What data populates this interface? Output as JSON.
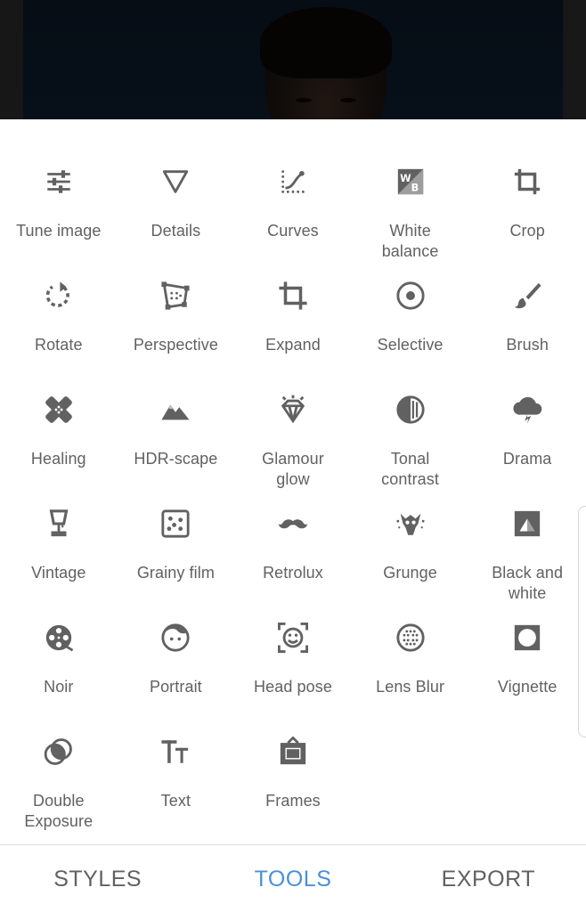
{
  "theme": {
    "icon_color": "#616161",
    "label_color": "#616161",
    "active_tab_color": "#4a90d9"
  },
  "tools": [
    {
      "label": "Tune image",
      "icon": "tune-icon"
    },
    {
      "label": "Details",
      "icon": "details-triangle-icon"
    },
    {
      "label": "Curves",
      "icon": "curves-icon"
    },
    {
      "label": "White\nbalance",
      "icon": "white-balance-icon"
    },
    {
      "label": "Crop",
      "icon": "crop-icon"
    },
    {
      "label": "Rotate",
      "icon": "rotate-icon"
    },
    {
      "label": "Perspective",
      "icon": "perspective-icon"
    },
    {
      "label": "Expand",
      "icon": "expand-icon"
    },
    {
      "label": "Selective",
      "icon": "selective-icon"
    },
    {
      "label": "Brush",
      "icon": "brush-icon"
    },
    {
      "label": "Healing",
      "icon": "healing-icon"
    },
    {
      "label": "HDR-scape",
      "icon": "hdr-mountains-icon"
    },
    {
      "label": "Glamour\nglow",
      "icon": "glamour-diamond-icon"
    },
    {
      "label": "Tonal\ncontrast",
      "icon": "tonal-contrast-icon"
    },
    {
      "label": "Drama",
      "icon": "drama-cloud-icon"
    },
    {
      "label": "Vintage",
      "icon": "vintage-lamp-icon"
    },
    {
      "label": "Grainy film",
      "icon": "grainy-film-icon"
    },
    {
      "label": "Retrolux",
      "icon": "retrolux-mustache-icon"
    },
    {
      "label": "Grunge",
      "icon": "grunge-icon"
    },
    {
      "label": "Black and\nwhite",
      "icon": "black-white-icon"
    },
    {
      "label": "Noir",
      "icon": "noir-film-reel-icon"
    },
    {
      "label": "Portrait",
      "icon": "portrait-face-icon"
    },
    {
      "label": "Head pose",
      "icon": "head-pose-icon"
    },
    {
      "label": "Lens Blur",
      "icon": "lens-blur-icon"
    },
    {
      "label": "Vignette",
      "icon": "vignette-icon"
    },
    {
      "label": "Double\nExposure",
      "icon": "double-exposure-icon"
    },
    {
      "label": "Text",
      "icon": "text-icon"
    },
    {
      "label": "Frames",
      "icon": "frames-icon"
    }
  ],
  "bottom_nav": {
    "styles": "STYLES",
    "tools": "TOOLS",
    "export": "EXPORT",
    "active": "tools"
  }
}
